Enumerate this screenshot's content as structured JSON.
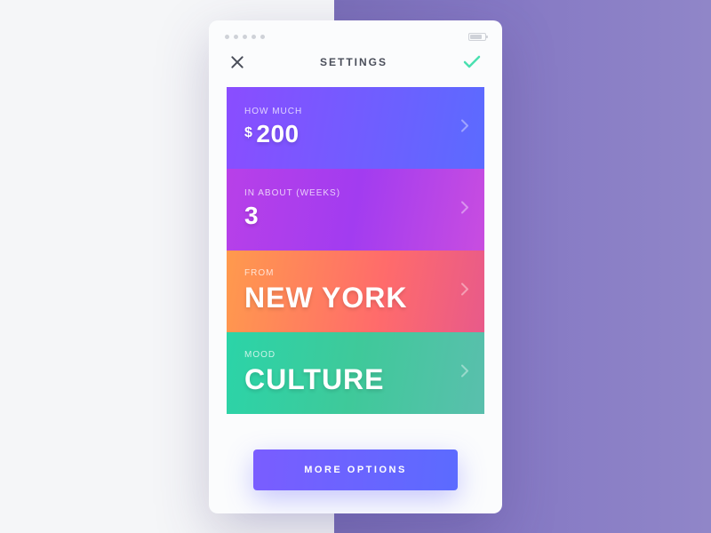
{
  "header": {
    "title": "SETTINGS"
  },
  "cards": [
    {
      "label": "HOW MUCH",
      "currency": "$",
      "value": "200"
    },
    {
      "label": "IN ABOUT (WEEKS)",
      "value": "3"
    },
    {
      "label": "FROM",
      "value": "NEW YORK"
    },
    {
      "label": "MOOD",
      "value": "CULTURE"
    }
  ],
  "footer": {
    "more_label": "MORE OPTIONS"
  }
}
